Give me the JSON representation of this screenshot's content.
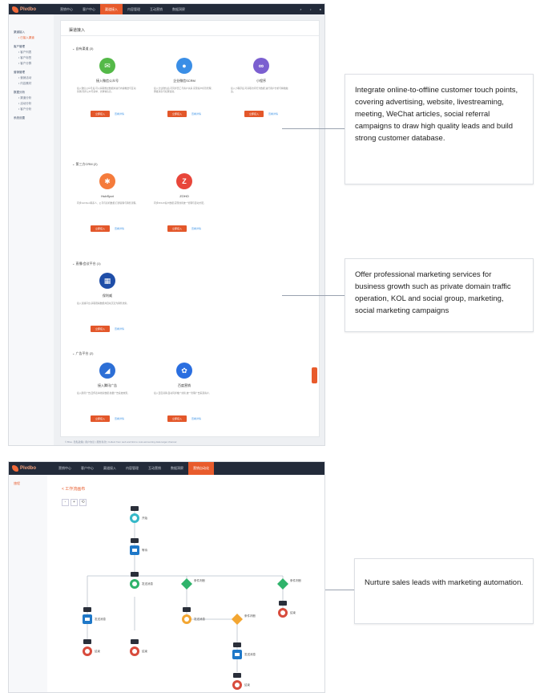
{
  "colors": {
    "accent": "#e85b2c",
    "topbar": "#232b3a",
    "flow_green": "#2fb36b",
    "flow_blue": "#1f78c8",
    "flow_orange": "#f3a632",
    "flow_red": "#d84b3c",
    "flow_teal": "#35b8c8"
  },
  "shot1": {
    "logo": "Pivdbo",
    "nav": [
      "营销中心",
      "客户中心",
      "渠道接入",
      "内容管理",
      "互动营销",
      "数据洞察"
    ],
    "nav_active_index": 2,
    "sidebar": {
      "groups": [
        {
          "title": "渠道接入",
          "items": [
            "已接入渠道"
          ]
        },
        {
          "title": "客户管理",
          "items": [
            "客户列表",
            "客户标签",
            "客户分群"
          ]
        },
        {
          "title": "营销管理",
          "items": [
            "营销活动",
            "内容素材"
          ]
        },
        {
          "title": "数据分析",
          "items": [
            "渠道分析",
            "活动分析",
            "客户分析"
          ]
        },
        {
          "title": "系统设置",
          "items": []
        }
      ]
    },
    "page_title": "渠道接入",
    "sections": [
      {
        "title": "自有渠道 (3)",
        "cards": [
          {
            "name": "接入微信公众号",
            "icon": "wechat-icon",
            "color": "#54b948",
            "glyph": "✉",
            "desc": "接入微信公众号后,可以获取粉丝数据并进行内容推送与互动营销,同步公众号菜单、文章等信息。",
            "primary": "立即接入",
            "link": "查看详情"
          },
          {
            "name": "企业微信SCRM",
            "icon": "chat-bubble-icon",
            "color": "#3a8ee6",
            "glyph": "●",
            "desc": "接入企业微信后,可同步员工与客户关系,实现客户标签管理、群发消息与社群运营。",
            "primary": "立即接入",
            "link": "查看详情"
          },
          {
            "name": "小程序",
            "icon": "link-icon",
            "color": "#7b5fd0",
            "glyph": "∞",
            "desc": "接入小程序后,可获取访问行为数据,进行用户分析与精准触达。",
            "primary": "立即接入",
            "link": "查看详情"
          }
        ]
      },
      {
        "title": "第三方CRM (2)",
        "cards": [
          {
            "name": "HubSpot",
            "icon": "hubspot-icon",
            "color": "#f57b3b",
            "glyph": "✱",
            "desc": "同步HubSpot联系人、公司与商机数据,打通营销与销售流程。",
            "primary": "立即接入",
            "link": "查看详情"
          },
          {
            "name": "ZOHO",
            "icon": "zoho-icon",
            "color": "#e8463a",
            "glyph": "Z",
            "desc": "同步ZOHO客户数据,实现线索统一管理与自动分配。",
            "primary": "立即接入",
            "link": "查看详情"
          }
        ]
      },
      {
        "title": "直播/会议平台 (1)",
        "cards": [
          {
            "name": "保利威",
            "icon": "polyv-icon",
            "color": "#1f4ea8",
            "glyph": "▦",
            "desc": "接入直播平台,获取观看数据并自动沉淀为销售线索。",
            "primary": "立即接入",
            "link": "查看详情"
          }
        ]
      },
      {
        "title": "广告平台 (2)",
        "cards": [
          {
            "name": "接入腾讯广告",
            "icon": "tencent-ads-icon",
            "color": "#2d6fd6",
            "glyph": "◢",
            "desc": "接入腾讯广告,回传表单线索数据,衡量广告投放效果。",
            "primary": "立即接入",
            "link": "查看详情"
          },
          {
            "name": "百度营销",
            "icon": "baidu-icon",
            "color": "#2a6ee0",
            "glyph": "✿",
            "desc": "接入百度营销,自动同步推广线索,统一管理广告来源客户。",
            "primary": "立即接入",
            "link": "查看详情"
          }
        ]
      }
    ],
    "footer": "© Bloo. 隐私政策 | 用户协议 | 服务条款 | Collect from web and link to cost-accounting data target channel"
  },
  "callouts": [
    "Integrate online-to-offline customer touch points, covering advertising, website, livestreaming, meeting, WeChat articles, social referral campaigns to draw high quality leads and build strong customer database.",
    "Offer professional marketing services for business growth such as private domain traffic operation, KOL and social group, marketing, social marketing campaigns",
    "Nurture sales leads with marketing automation."
  ],
  "shot2": {
    "logo": "Pivdbo",
    "nav": [
      "营销中心",
      "客户中心",
      "渠道接入",
      "内容管理",
      "互动营销",
      "数据洞察",
      "营销自动化"
    ],
    "nav_active_index": 6,
    "sidebar_item": "旅程",
    "breadcrumb": "< 工作流画布",
    "zoom": [
      "-",
      "+",
      "⟲"
    ],
    "flow_labels": {
      "start": "开始",
      "wait": "等待",
      "msg": "发送消息",
      "cond": "条件判断",
      "end": "结束"
    }
  }
}
